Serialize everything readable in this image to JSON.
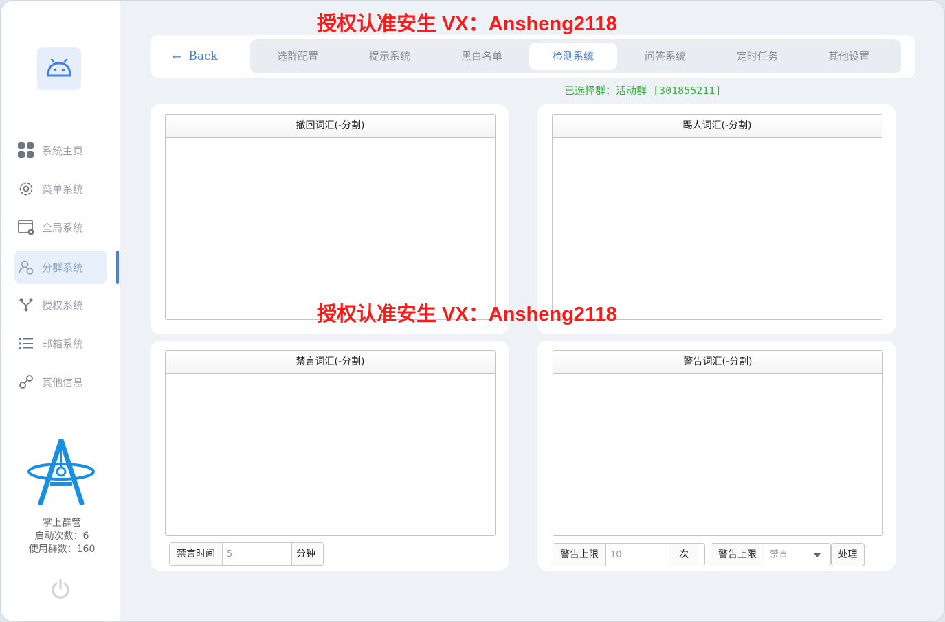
{
  "watermark": {
    "text": "授权认准安生 VX：Ansheng2118",
    "color": "#ff1a1a"
  },
  "sidebar": {
    "items": [
      {
        "label": "系统主页",
        "icon": "grid-icon"
      },
      {
        "label": "菜单系统",
        "icon": "gear-icon"
      },
      {
        "label": "全局系统",
        "icon": "window-settings-icon"
      },
      {
        "label": "分群系统",
        "icon": "user-group-icon",
        "active": true
      },
      {
        "label": "授权系统",
        "icon": "branch-icon"
      },
      {
        "label": "邮箱系统",
        "icon": "list-icon"
      },
      {
        "label": "其他信息",
        "icon": "link-icon"
      }
    ],
    "brand": {
      "name": "掌上群管",
      "launches": "启动次数：6",
      "groups_used": "使用群数：160"
    }
  },
  "topbar": {
    "back_label": "Back",
    "tabs": [
      "选群配置",
      "提示系统",
      "黑白名单",
      "检测系统",
      "问答系统",
      "定时任务",
      "其他设置"
    ],
    "active_tab": "检测系统"
  },
  "status": {
    "selected_group": "已选择群：活动群 [301855211]"
  },
  "panels": {
    "recall": {
      "title": "撤回词汇(-分割)",
      "value": ""
    },
    "kick": {
      "title": "踢人词汇(-分割)",
      "value": ""
    },
    "mute": {
      "title": "禁言词汇(-分割)",
      "value": ""
    },
    "warn": {
      "title": "警告词汇(-分割)",
      "value": ""
    }
  },
  "mute_time": {
    "label": "禁言时间",
    "value": "5",
    "unit": "分钟"
  },
  "warn_limit": {
    "label": "警告上限",
    "value": "10",
    "unit": "次"
  },
  "warn_action": {
    "label": "警告上限",
    "selected": "禁言",
    "button": "处理"
  },
  "colors": {
    "accent": "#3d82f0",
    "status_green": "#34b23a",
    "watermark_red": "#ff1a1a"
  }
}
